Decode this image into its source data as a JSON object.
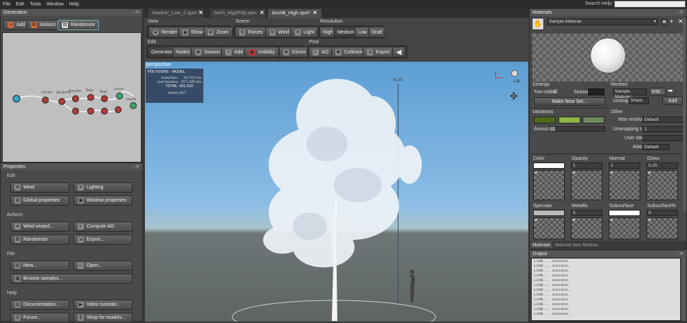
{
  "menu": {
    "items": [
      "File",
      "Edit",
      "Tools",
      "Window",
      "Help"
    ],
    "search_label": "Search Help:",
    "search_value": ""
  },
  "generation": {
    "title": "Generation",
    "buttons": {
      "add": "Add",
      "actions": "Actions",
      "randomize": "Randomize"
    },
    "nodes": [
      "Cylinder",
      "Big Spines",
      "Branches",
      "Twigs",
      "Twigs",
      "Leaves",
      "Leaves"
    ]
  },
  "tabs": [
    {
      "label": "heather_Low_2.spm*",
      "selected": false
    },
    {
      "label": "birch_HighPoly.spm",
      "selected": false
    },
    {
      "label": "birchB_High.spm*",
      "selected": true
    }
  ],
  "toolbar": {
    "view": {
      "title": "View",
      "render": "Render",
      "show": "Show",
      "zoom": "Zoom"
    },
    "scene": {
      "title": "Scene",
      "forces": "Forces",
      "wind": "Wind",
      "light": "Light"
    },
    "resolution": {
      "title": "Resolution",
      "options": [
        "High",
        "Medium",
        "Low",
        "Draft"
      ],
      "selected": "Medium"
    },
    "edit": {
      "title": "Edit",
      "generators": "Generators",
      "nodes": "Nodes",
      "season": "Season",
      "add": "Add",
      "visibility": "Visibility",
      "gizmo": "Gizmo"
    },
    "post": {
      "title": "Post",
      "ao": "AO",
      "collision": "Collision",
      "export": "Export"
    }
  },
  "viewport": {
    "camera": "perspective",
    "stats_title": "POLYGONS - MODEL",
    "stats": [
      {
        "label": "branches:",
        "value": "59,702 tris"
      },
      {
        "label": "leaf meshes:",
        "value": "871,908 tris"
      },
      {
        "label": "TOTAL:",
        "value": "931,610"
      }
    ],
    "bones_label": "bones:",
    "bones_value": "827",
    "height_label": "43.30",
    "scale_label": "2.90"
  },
  "properties": {
    "title": "Properties",
    "edit": {
      "title": "Edit",
      "wind": "Wind",
      "lighting": "Lighting",
      "global": "Global properties",
      "window": "Window properties"
    },
    "actions": {
      "title": "Actions",
      "wind_wizard": "Wind wizard...",
      "compute_ao": "Compute AO",
      "randomize": "Randomize",
      "export": "Export..."
    },
    "file": {
      "title": "File",
      "new": "New...",
      "open": "Open...",
      "browse": "Browse samples..."
    },
    "help": {
      "title": "Help",
      "documentation": "Documentation...",
      "video": "Video tutorials...",
      "forum": "Forum...",
      "shop": "Shop for models..."
    }
  },
  "materials": {
    "title": "Materials",
    "selected": "Sample Material",
    "settings": {
      "title": "Settings",
      "two_sided": "Two-sided",
      "season": "Season",
      "make_new_set": "Make New Set..."
    },
    "meshes": {
      "title": "Meshes",
      "selected": "Sample Material",
      "edit": "Edit...",
      "unwrap_label": "Unwrap",
      "unwrap_value": "Share",
      "add": "Add"
    },
    "variations": {
      "title": "Variations",
      "amount": "Amount",
      "colors": [
        "#4f6a18",
        "#8db544",
        "#6e8a5e"
      ]
    },
    "other": {
      "title": "Other",
      "max_res_label": "Max resolution",
      "max_res_value": "Default",
      "unwrap_scale_label": "Unwrapping scale",
      "unwrap_scale_value": "1",
      "user_data_label": "User data",
      "user_data_value": "",
      "atlas_label": "Atlas",
      "atlas_value": "Default"
    },
    "maps_row1": [
      {
        "label": "Color",
        "value": ""
      },
      {
        "label": "Opacity",
        "value": "1"
      },
      {
        "label": "Normal",
        "value": "1"
      },
      {
        "label": "Gloss",
        "value": "0.25"
      }
    ],
    "maps_row2": [
      {
        "label": "Specular",
        "value": ""
      },
      {
        "label": "Metallic",
        "value": "0"
      },
      {
        "label": "Subsurface",
        "value": ""
      },
      {
        "label": "Subsurface%",
        "value": "0"
      }
    ],
    "bottom_tabs": [
      "Materials",
      "Material Sets",
      "Meshes"
    ]
  },
  "output": {
    "title": "Output",
    "lines": [
      "LibA... success.",
      "LibA... success.",
      "LibA... success.",
      "LibA... success.",
      "LibA... success.",
      "LibA... success.",
      "LibA... success.",
      "LibA... success.",
      "LibA... success.",
      "LibA... success.",
      "LibA... success.",
      "LibA... success."
    ]
  }
}
